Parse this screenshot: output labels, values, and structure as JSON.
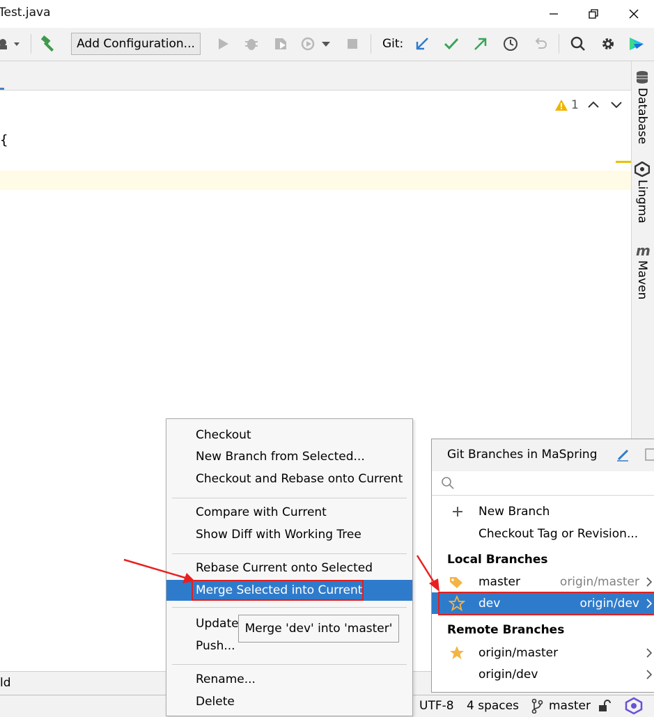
{
  "window": {
    "title": "Test.java"
  },
  "toolbar": {
    "add_configuration": "Add Configuration...",
    "git_label": "Git:"
  },
  "editor": {
    "code_brace": "{",
    "warning_count": "1",
    "bottom_left_text": "ld"
  },
  "right_sidebar": {
    "database": "Database",
    "lingma": "Lingma",
    "maven": "Maven"
  },
  "context_menu": {
    "checkout": "Checkout",
    "new_branch_from_selected": "New Branch from Selected...",
    "checkout_rebase": "Checkout and Rebase onto Current",
    "compare_with_current": "Compare with Current",
    "show_diff": "Show Diff with Working Tree",
    "rebase_current": "Rebase Current onto Selected",
    "merge_selected": "Merge Selected into Current",
    "update": "Update",
    "push": "Push...",
    "rename": "Rename...",
    "delete": "Delete",
    "tooltip": "Merge 'dev' into 'master'"
  },
  "branches_popup": {
    "title": "Git Branches in MaSpring",
    "new_branch": "New Branch",
    "checkout_tag": "Checkout Tag or Revision...",
    "local_heading": "Local Branches",
    "local": [
      {
        "name": "master",
        "tracking": "origin/master"
      },
      {
        "name": "dev",
        "tracking": "origin/dev"
      }
    ],
    "remote_heading": "Remote Branches",
    "remote": [
      {
        "name": "origin/master"
      },
      {
        "name": "origin/dev"
      }
    ]
  },
  "statusbar": {
    "encoding": "UTF-8",
    "indent": "4 spaces",
    "branch": "master"
  },
  "colors": {
    "selection": "#2f7bcb",
    "highlight_box": "#e02020",
    "git_blue": "#2f7bcb",
    "git_green": "#3aa35a"
  }
}
